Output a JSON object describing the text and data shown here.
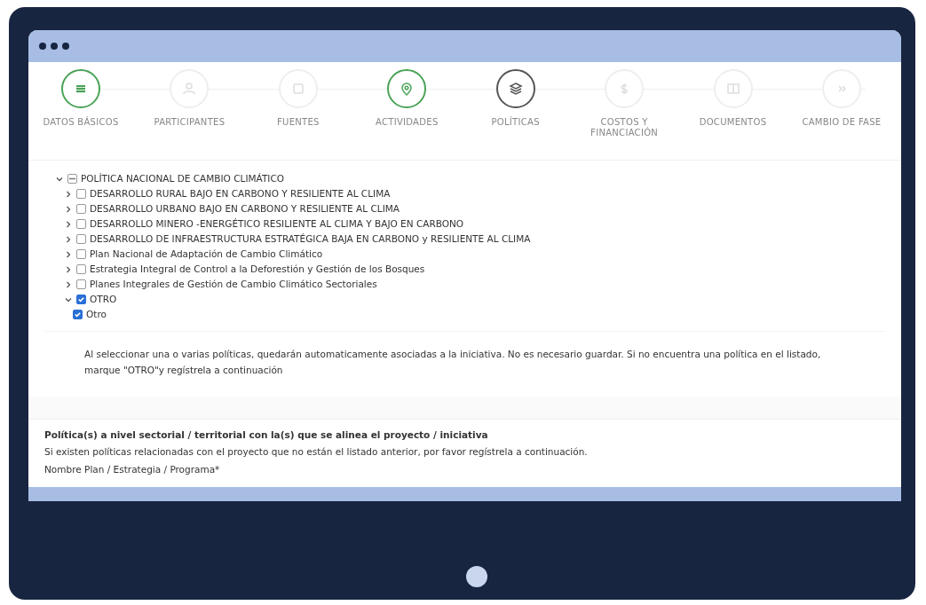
{
  "steps": [
    {
      "label": "DATOS BÁSICOS",
      "completed": true,
      "selected": false
    },
    {
      "label": "PARTICIPANTES",
      "completed": false,
      "selected": false
    },
    {
      "label": "FUENTES",
      "completed": false,
      "selected": false
    },
    {
      "label": "ACTIVIDADES",
      "completed": true,
      "selected": false
    },
    {
      "label": "POLÍTICAS",
      "completed": false,
      "selected": true
    },
    {
      "label": "COSTOS Y FINANCIACIÓN",
      "completed": false,
      "selected": false
    },
    {
      "label": "DOCUMENTOS",
      "completed": false,
      "selected": false
    },
    {
      "label": "CAMBIO DE FASE",
      "completed": false,
      "selected": false
    }
  ],
  "tree": [
    {
      "label": "POLÍTICA NACIONAL DE CAMBIO CLIMÁTICO",
      "expanded": true,
      "indeterminate": true,
      "children": [
        {
          "label": "DESARROLLO RURAL BAJO EN CARBONO Y RESILIENTE AL CLIMA",
          "expanded": false,
          "checked": false
        },
        {
          "label": "DESARROLLO URBANO BAJO EN CARBONO Y RESILIENTE AL CLIMA",
          "expanded": false,
          "checked": false
        },
        {
          "label": "DESARROLLO MINERO -ENERGÉTICO RESILIENTE AL CLIMA Y BAJO EN CARBONO",
          "expanded": false,
          "checked": false
        },
        {
          "label": "DESARROLLO DE INFRAESTRUCTURA ESTRATÉGICA BAJA EN CARBONO y RESILIENTE AL CLIMA",
          "expanded": false,
          "checked": false
        },
        {
          "label": "Plan Nacional de Adaptación de Cambio Climático",
          "expanded": false,
          "checked": false
        },
        {
          "label": "Estrategia Integral de Control a la Deforestión y Gestión de los Bosques",
          "expanded": false,
          "checked": false
        },
        {
          "label": "Planes Integrales de Gestión de Cambio Climático Sectoriales",
          "expanded": false,
          "checked": false
        },
        {
          "label": "OTRO",
          "expanded": true,
          "checked": true,
          "children": [
            {
              "label": "Otro",
              "checked": true
            }
          ]
        }
      ]
    }
  ],
  "note": "Al seleccionar una o varias políticas, quedarán automaticamente asociadas a la iniciativa. No es necesario guardar. Si no encuentra una política en el listado, marque \"OTRO\"y regístrela a continuación",
  "section": {
    "title": "Política(s) a nivel sectorial / territorial con la(s) que se alinea el proyecto / iniciativa",
    "description": "Si existen políticas relacionadas con el proyecto que no están el listado anterior, por favor regístrela a continuación.",
    "field_label": "Nombre Plan / Estrategia / Programa*"
  }
}
